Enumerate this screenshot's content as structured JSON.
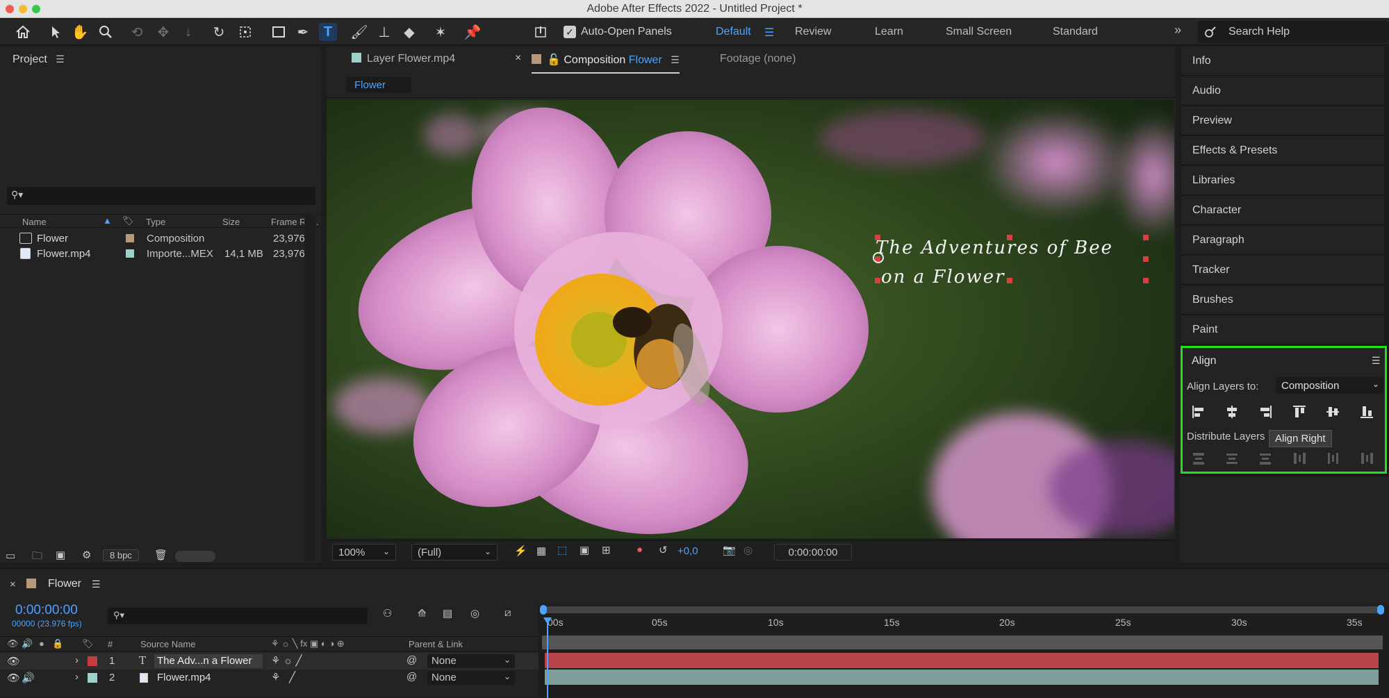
{
  "window": {
    "title": "Adobe After Effects 2022 - Untitled Project *"
  },
  "toolbar": {
    "auto_open_panels": "Auto-Open Panels",
    "workspaces": [
      "Default",
      "Review",
      "Learn",
      "Small Screen",
      "Standard"
    ],
    "active_workspace": "Default",
    "search_placeholder": "Search Help"
  },
  "project": {
    "title": "Project",
    "columns": [
      "Name",
      "Type",
      "Size",
      "Frame Ra..."
    ],
    "items": [
      {
        "name": "Flower",
        "label_color": "#b69a78",
        "type": "Composition",
        "size": "",
        "fps": "23,976"
      },
      {
        "name": "Flower.mp4",
        "label_color": "#9dd0c8",
        "type": "Importe...MEX",
        "size": "14,1 MB",
        "fps": "23,976"
      }
    ],
    "bpc": "8 bpc"
  },
  "viewer": {
    "tabs": [
      {
        "label": "Layer Flower.mp4"
      },
      {
        "label": "Composition",
        "comp": "Flower"
      },
      {
        "label": "Footage (none)"
      }
    ],
    "breadcrumb": "Flower",
    "overlay_line1": "The Adventures of Bee",
    "overlay_line2": "on a Flower",
    "zoom": "100%",
    "resolution": "(Full)",
    "exposure": "+0,0",
    "timecode": "0:00:00:00"
  },
  "right_panels": [
    "Info",
    "Audio",
    "Preview",
    "Effects & Presets",
    "Libraries",
    "Character",
    "Paragraph",
    "Tracker",
    "Brushes",
    "Paint"
  ],
  "align": {
    "title": "Align",
    "align_to_label": "Align Layers to:",
    "align_to_value": "Composition",
    "distribute_label": "Distribute Layers",
    "tooltip": "Align Right",
    "highlight_color": "#22e01a"
  },
  "timeline": {
    "comp_name": "Flower",
    "timecode": "0:00:00:00",
    "frame_info": "00000 (23.976 fps)",
    "headers": {
      "num": "#",
      "source": "Source Name",
      "parent": "Parent & Link"
    },
    "ruler": [
      "00s",
      "05s",
      "10s",
      "15s",
      "20s",
      "25s",
      "30s",
      "35s"
    ],
    "layers": [
      {
        "num": "1",
        "name": "The Adv...n a Flower",
        "color": "#c43c3c",
        "parent": "None",
        "bar_color": "#b9454a"
      },
      {
        "num": "2",
        "name": "Flower.mp4",
        "color": "#9dd0c8",
        "parent": "None",
        "bar_color": "#7f9d99"
      }
    ]
  }
}
